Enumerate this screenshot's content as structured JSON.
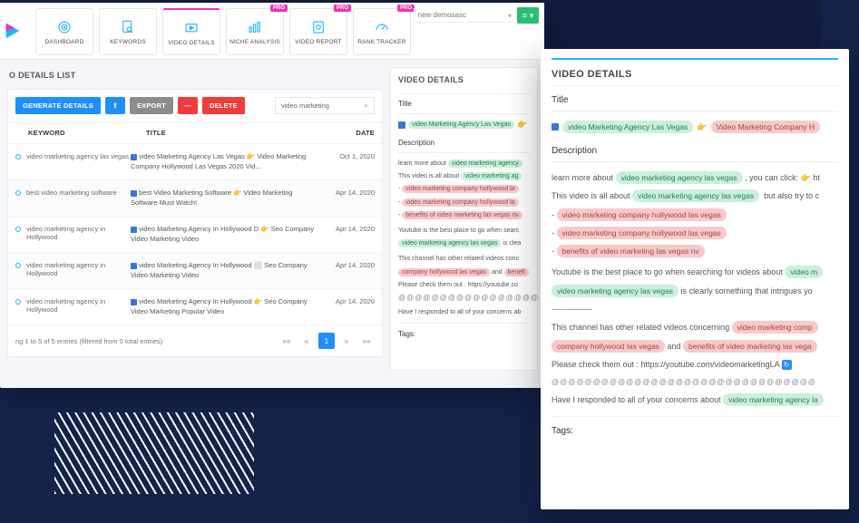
{
  "top": {
    "demo_label": "new demosasc",
    "nav": [
      {
        "label": "DASHBOARD",
        "pro": false
      },
      {
        "label": "KEYWORDS",
        "pro": false
      },
      {
        "label": "VIDEO DETAILS",
        "pro": false
      },
      {
        "label": "NICHE ANALYSIS",
        "pro": true
      },
      {
        "label": "VIDEO REPORT",
        "pro": true
      },
      {
        "label": "RANK TRACKER",
        "pro": true
      }
    ]
  },
  "list": {
    "panel_title": "O DETAILS LIST",
    "btn_generate": "GENERATE DETAILS",
    "btn_export": "EXPORT",
    "btn_delete": "DELETE",
    "search_value": "video marketing",
    "cols": {
      "keyword": "KEYWORD",
      "title": "TITLE",
      "date": "DATE"
    },
    "rows": [
      {
        "kw": "video marketing agency las vegas",
        "title": "video Marketing Agency Las Vegas 👉 Video Marketing Company Hollywood Las Vegas 2020 Vid...",
        "date": "Oct 1, 2020"
      },
      {
        "kw": "best video marketing software",
        "title": "best Video Marketing Software 👉 Video Marketing Software Must Watch!",
        "date": "Apr 14, 2020"
      },
      {
        "kw": "video marketing agency in Hollywood",
        "title": "video Marketing Agency In Hollywood D 👉 Seo Company Video Marketing Video",
        "date": "Apr 14, 2020"
      },
      {
        "kw": "video marketing agency in Hollywood",
        "title": "video Marketing Agency In Hollywood ⬜ Seo Company Video Marketing Video",
        "date": "Apr 14, 2020"
      },
      {
        "kw": "video marketing agency in Hollywood",
        "title": "video Marketing Agency In Hollywood 👉 Seo Company Video Marketing Popular Video",
        "date": "Apr 14, 2020"
      }
    ],
    "footer": "ng 1 to 5 of 5 entries (filtered from 0 total entries)",
    "page": "1"
  },
  "mid": {
    "head": "VIDEO DETAILS",
    "title_hdr": "Title",
    "title_chip": "video Marketing Agency Las Vegas",
    "desc_hdr": "Description",
    "d1a": "learn more about",
    "d1b": "video marketing agency",
    "d2a": "This video is all about",
    "d2b": "video marketing ag",
    "d3": "video marketing company hollywood la",
    "d4": "video marketing company hollywood la",
    "d5": "benefits of video marketing las vegas nv",
    "d6a": "Youtube is the best place to go when searc",
    "d6b": "video marketing agency las vegas",
    "d6c": "is clea",
    "d7a": "This channel has other related videos conc",
    "d7b": "company hollywood las vegas",
    "d7c": "and",
    "d7d": "benefi",
    "d8": "Please check them out : https://youtube.co",
    "d9": "Have I responded to all of your concerns ab",
    "tags": "Tags:"
  },
  "ov": {
    "head": "VIDEO DETAILS",
    "title_hdr": "Title",
    "t1": "video Marketing Agency Las Vegas",
    "t2": "Video Marketing Company H",
    "desc_hdr": "Description",
    "p1a": "learn more about",
    "p1b": "video marketing agency las vegas",
    "p1c": ", you can click: 👉 ht",
    "p2a": "This video is all about",
    "p2b": "video marketing agency las vegas",
    "p2c": "but also try to c",
    "b1": "video marketing company hollywood las vegas",
    "b2": "video marketing company hollywood las vegas",
    "b3": "benefits of video marketing las vegas nv",
    "p3a": "Youtube is the best place to go when searching for videos about",
    "p3b": "video m",
    "p3c": "video marketing agency las vegas",
    "p3d": "is clearly something that intrigues yo",
    "dots": "---------------",
    "p4a": "This channel has other related videos concerning",
    "p4b": "video marketing comp",
    "p4c": "company hollywood las vegas",
    "p4d": "and",
    "p4e": "benefits of video marketing las vega",
    "p5": "Please check them out : https://youtube.com/videomarketingLA",
    "emoji": "@@@@@@@@@@@@@@@@@@@@@@@@@@@@@@@@",
    "p6a": "Have I responded to all of your concerns about",
    "p6b": "video marketing agency la",
    "tags": "Tags:"
  }
}
